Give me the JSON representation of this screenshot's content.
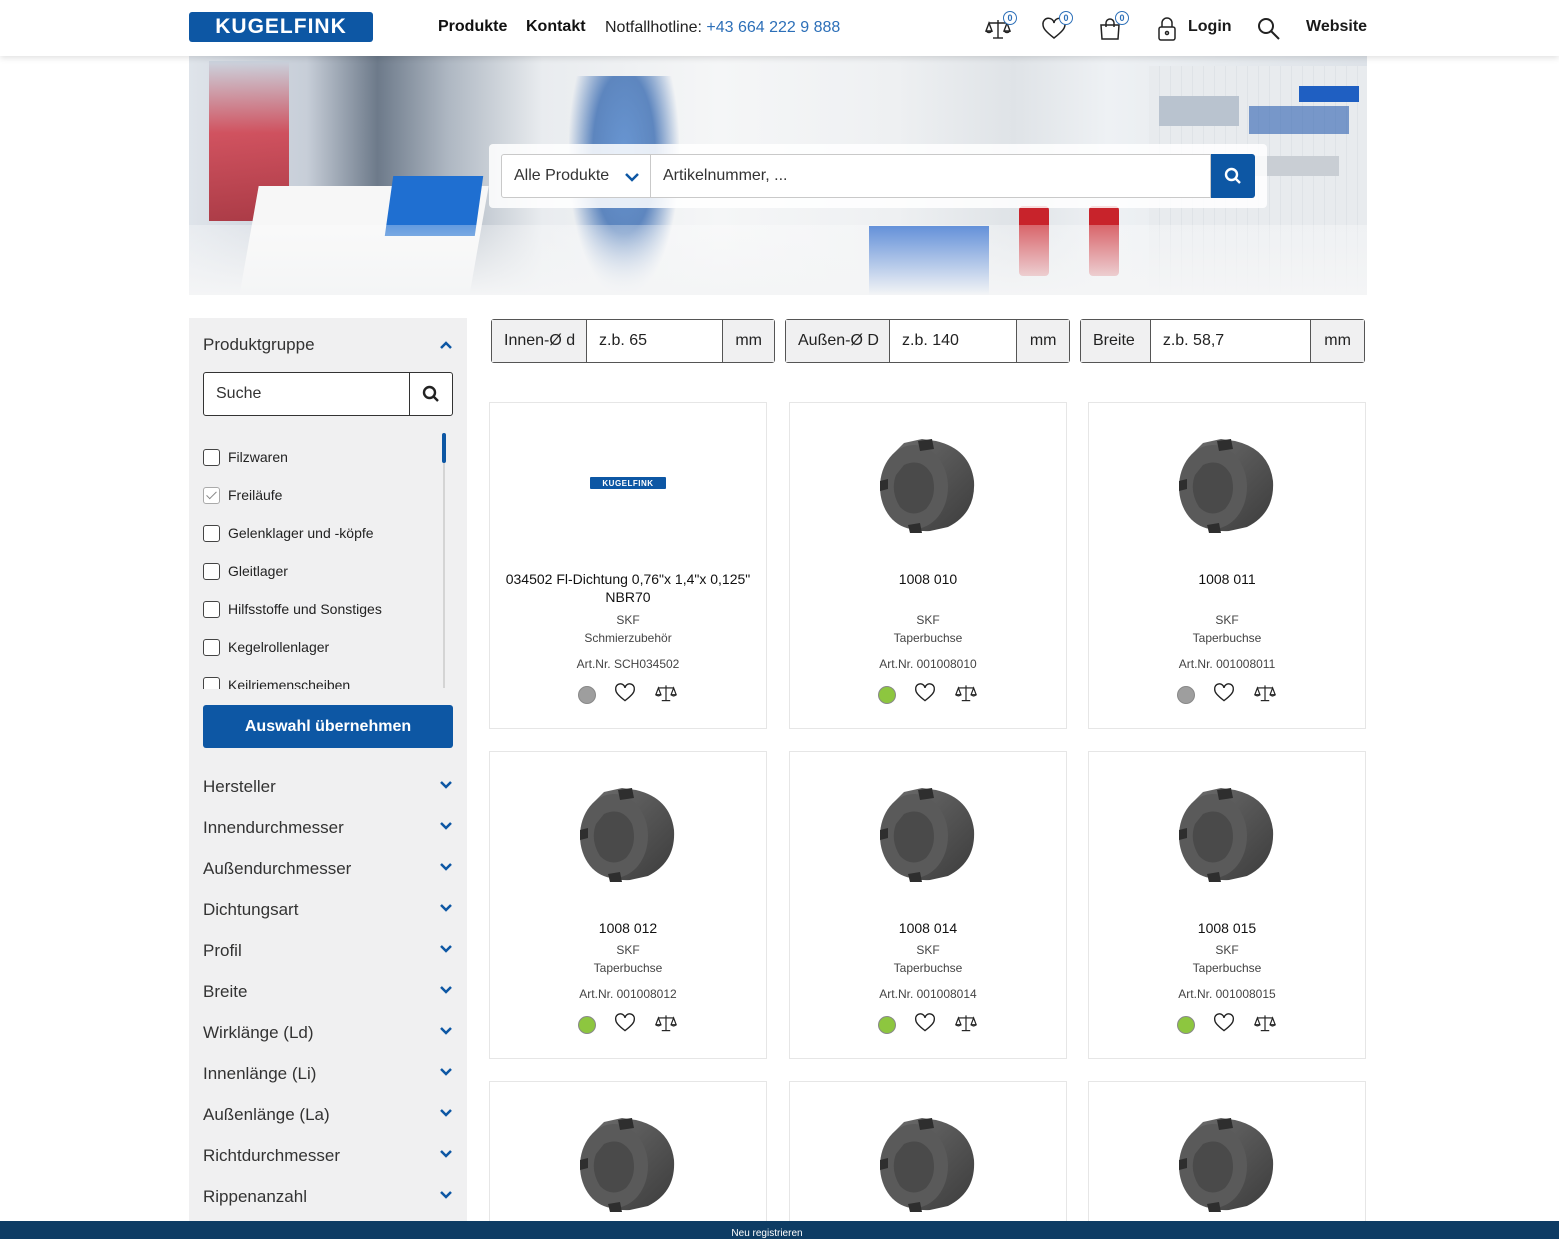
{
  "header": {
    "logo_text": "KUGELFINK",
    "nav": {
      "products": "Produkte",
      "contact": "Kontakt"
    },
    "hotline_label": "Notfallhotline:",
    "hotline_number": "+43 664 222 9 888",
    "compare_count": "0",
    "wishlist_count": "0",
    "cart_count": "0",
    "login": "Login",
    "website": "Website"
  },
  "hero_search": {
    "category_selected": "Alle Produkte",
    "placeholder": "Artikelnummer, ..."
  },
  "sidebar": {
    "group_title": "Produktgruppe",
    "search_placeholder": "Suche",
    "groups": [
      {
        "label": "Filzwaren",
        "checked": false
      },
      {
        "label": "Freiläufe",
        "checked": true
      },
      {
        "label": "Gelenklager und -köpfe",
        "checked": false
      },
      {
        "label": "Gleitlager",
        "checked": false
      },
      {
        "label": "Hilfsstoffe und Sonstiges",
        "checked": false
      },
      {
        "label": "Kegelrollenlager",
        "checked": false
      },
      {
        "label": "Keilriemenscheiben",
        "checked": false
      }
    ],
    "apply_label": "Auswahl übernehmen",
    "facets": [
      "Hersteller",
      "Innendurchmesser",
      "Außendurchmesser",
      "Dichtungsart",
      "Profil",
      "Breite",
      "Wirklänge (Ld)",
      "Innenlänge (Li)",
      "Außenlänge (La)",
      "Richtdurchmesser",
      "Rippenanzahl"
    ]
  },
  "dimension_filters": [
    {
      "label": "Innen-Ø d",
      "placeholder": "z.b. 65",
      "unit": "mm"
    },
    {
      "label": "Außen-Ø D",
      "placeholder": "z.b. 140",
      "unit": "mm"
    },
    {
      "label": "Breite",
      "placeholder": "z.b. 58,7",
      "unit": "mm"
    }
  ],
  "products": [
    {
      "name": "034502 Fl-Dichtung 0,76\"x 1,4\"x 0,125\" NBR70",
      "brand": "SKF",
      "category": "Schmierzubehör",
      "artnr": "Art.Nr. SCH034502",
      "availability": "grey",
      "image": "kugelfink-logo"
    },
    {
      "name": "1008 010",
      "brand": "SKF",
      "category": "Taperbuchse",
      "artnr": "Art.Nr. 001008010",
      "availability": "green",
      "image": "taper-bush"
    },
    {
      "name": "1008 011",
      "brand": "SKF",
      "category": "Taperbuchse",
      "artnr": "Art.Nr. 001008011",
      "availability": "grey",
      "image": "taper-bush"
    },
    {
      "name": "1008 012",
      "brand": "SKF",
      "category": "Taperbuchse",
      "artnr": "Art.Nr. 001008012",
      "availability": "green",
      "image": "taper-bush"
    },
    {
      "name": "1008 014",
      "brand": "SKF",
      "category": "Taperbuchse",
      "artnr": "Art.Nr. 001008014",
      "availability": "green",
      "image": "taper-bush"
    },
    {
      "name": "1008 015",
      "brand": "SKF",
      "category": "Taperbuchse",
      "artnr": "Art.Nr. 001008015",
      "availability": "green",
      "image": "taper-bush"
    },
    {
      "name": "",
      "brand": "",
      "category": "",
      "artnr": "",
      "availability": "",
      "image": "taper-bush"
    },
    {
      "name": "",
      "brand": "",
      "category": "",
      "artnr": "",
      "availability": "",
      "image": "taper-bush"
    },
    {
      "name": "",
      "brand": "",
      "category": "",
      "artnr": "",
      "availability": "",
      "image": "taper-bush"
    }
  ],
  "colors": {
    "brand_blue": "#0d57a4",
    "link_blue": "#2c6fb8",
    "available_green": "#8dc63f",
    "unavailable_grey": "#9e9e9e",
    "footer_navy": "#0e3c64"
  },
  "footer": {
    "register": "Neu registrieren"
  }
}
